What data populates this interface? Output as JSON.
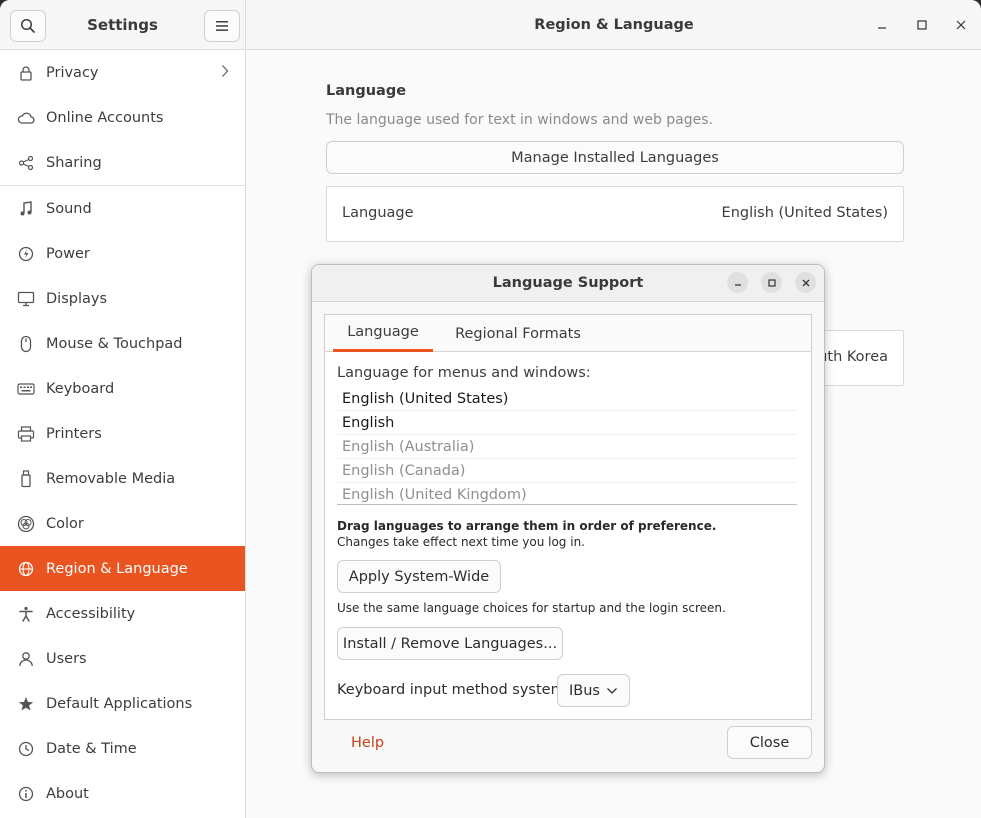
{
  "sidebar": {
    "title": "Settings",
    "items": [
      {
        "label": "Privacy",
        "icon": "lock-icon"
      },
      {
        "label": "Online Accounts",
        "icon": "cloud-icon"
      },
      {
        "label": "Sharing",
        "icon": "share-icon"
      },
      {
        "label": "Sound",
        "icon": "music-note-icon"
      },
      {
        "label": "Power",
        "icon": "power-icon"
      },
      {
        "label": "Displays",
        "icon": "display-icon"
      },
      {
        "label": "Mouse & Touchpad",
        "icon": "mouse-icon"
      },
      {
        "label": "Keyboard",
        "icon": "keyboard-icon"
      },
      {
        "label": "Printers",
        "icon": "printer-icon"
      },
      {
        "label": "Removable Media",
        "icon": "usb-drive-icon"
      },
      {
        "label": "Color",
        "icon": "color-icon"
      },
      {
        "label": "Region & Language",
        "icon": "globe-icon"
      },
      {
        "label": "Accessibility",
        "icon": "accessibility-icon"
      },
      {
        "label": "Users",
        "icon": "user-icon"
      },
      {
        "label": "Default Applications",
        "icon": "star-icon"
      },
      {
        "label": "Date & Time",
        "icon": "clock-icon"
      },
      {
        "label": "About",
        "icon": "info-icon"
      }
    ],
    "active_index": 11
  },
  "main": {
    "title": "Region & Language",
    "language_section_title": "Language",
    "language_section_subtitle": "The language used for text in windows and web pages.",
    "manage_button": "Manage Installed Languages",
    "language_row_label": "Language",
    "language_row_value": "English (United States)",
    "formats_row_value_partial": "uth Korea"
  },
  "dialog": {
    "title": "Language Support",
    "tabs": [
      "Language",
      "Regional Formats"
    ],
    "active_tab": 0,
    "list_label": "Language for menus and windows:",
    "languages": [
      {
        "label": "English (United States)",
        "enabled": true
      },
      {
        "label": "English",
        "enabled": true
      },
      {
        "label": "English (Australia)",
        "enabled": false
      },
      {
        "label": "English (Canada)",
        "enabled": false
      },
      {
        "label": "English (United Kingdom)",
        "enabled": false
      }
    ],
    "drag_hint": "Drag languages to arrange them in order of preference.",
    "effect_hint": "Changes take effect next time you log in.",
    "apply_button": "Apply System-Wide",
    "apply_hint": "Use the same language choices for startup and the login screen.",
    "install_button": "Install / Remove Languages...",
    "keyboard_label": "Keyboard input method system:",
    "keyboard_value": "IBus",
    "help_link": "Help",
    "close_button": "Close"
  },
  "colors": {
    "accent": "#e95420",
    "help_link": "#c7411b"
  }
}
